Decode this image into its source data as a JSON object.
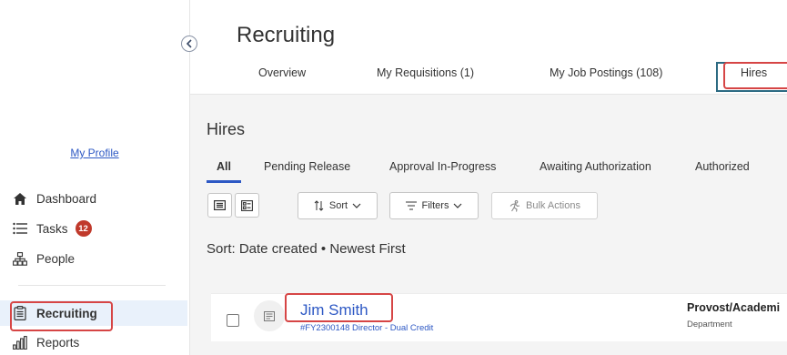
{
  "sidebar": {
    "profile_link": "My Profile",
    "items": [
      {
        "label": "Dashboard",
        "icon": "home-icon"
      },
      {
        "label": "Tasks",
        "icon": "tasks-list-icon",
        "badge": "12"
      },
      {
        "label": "People",
        "icon": "org-chart-icon"
      },
      {
        "label": "Recruiting",
        "icon": "clipboard-icon",
        "active": true
      },
      {
        "label": "Reports",
        "icon": "bar-chart-icon"
      }
    ]
  },
  "header": {
    "title": "Recruiting",
    "tabs": [
      {
        "label": "Overview"
      },
      {
        "label": "My Requisitions (1)"
      },
      {
        "label": "My Job Postings (108)"
      },
      {
        "label": "Hires",
        "active": true
      }
    ]
  },
  "hires": {
    "title": "Hires",
    "subtabs": [
      {
        "label": "All",
        "active": true
      },
      {
        "label": "Pending Release"
      },
      {
        "label": "Approval In-Progress"
      },
      {
        "label": "Awaiting Authorization"
      },
      {
        "label": "Authorized"
      }
    ],
    "toolbar": {
      "sort_label": "Sort",
      "filters_label": "Filters",
      "bulk_label": "Bulk Actions"
    },
    "sort_summary": "Sort: Date created • Newest First",
    "rows": [
      {
        "name": "Jim Smith",
        "subtitle": "#FY2300148 Director - Dual Credit",
        "department": "Provost/Academi",
        "department_label": "Department"
      }
    ]
  },
  "colors": {
    "accent": "#2d58c4",
    "badge": "#c0392b",
    "annotation": "#d64545",
    "active_tab_border": "#2c6a82"
  }
}
